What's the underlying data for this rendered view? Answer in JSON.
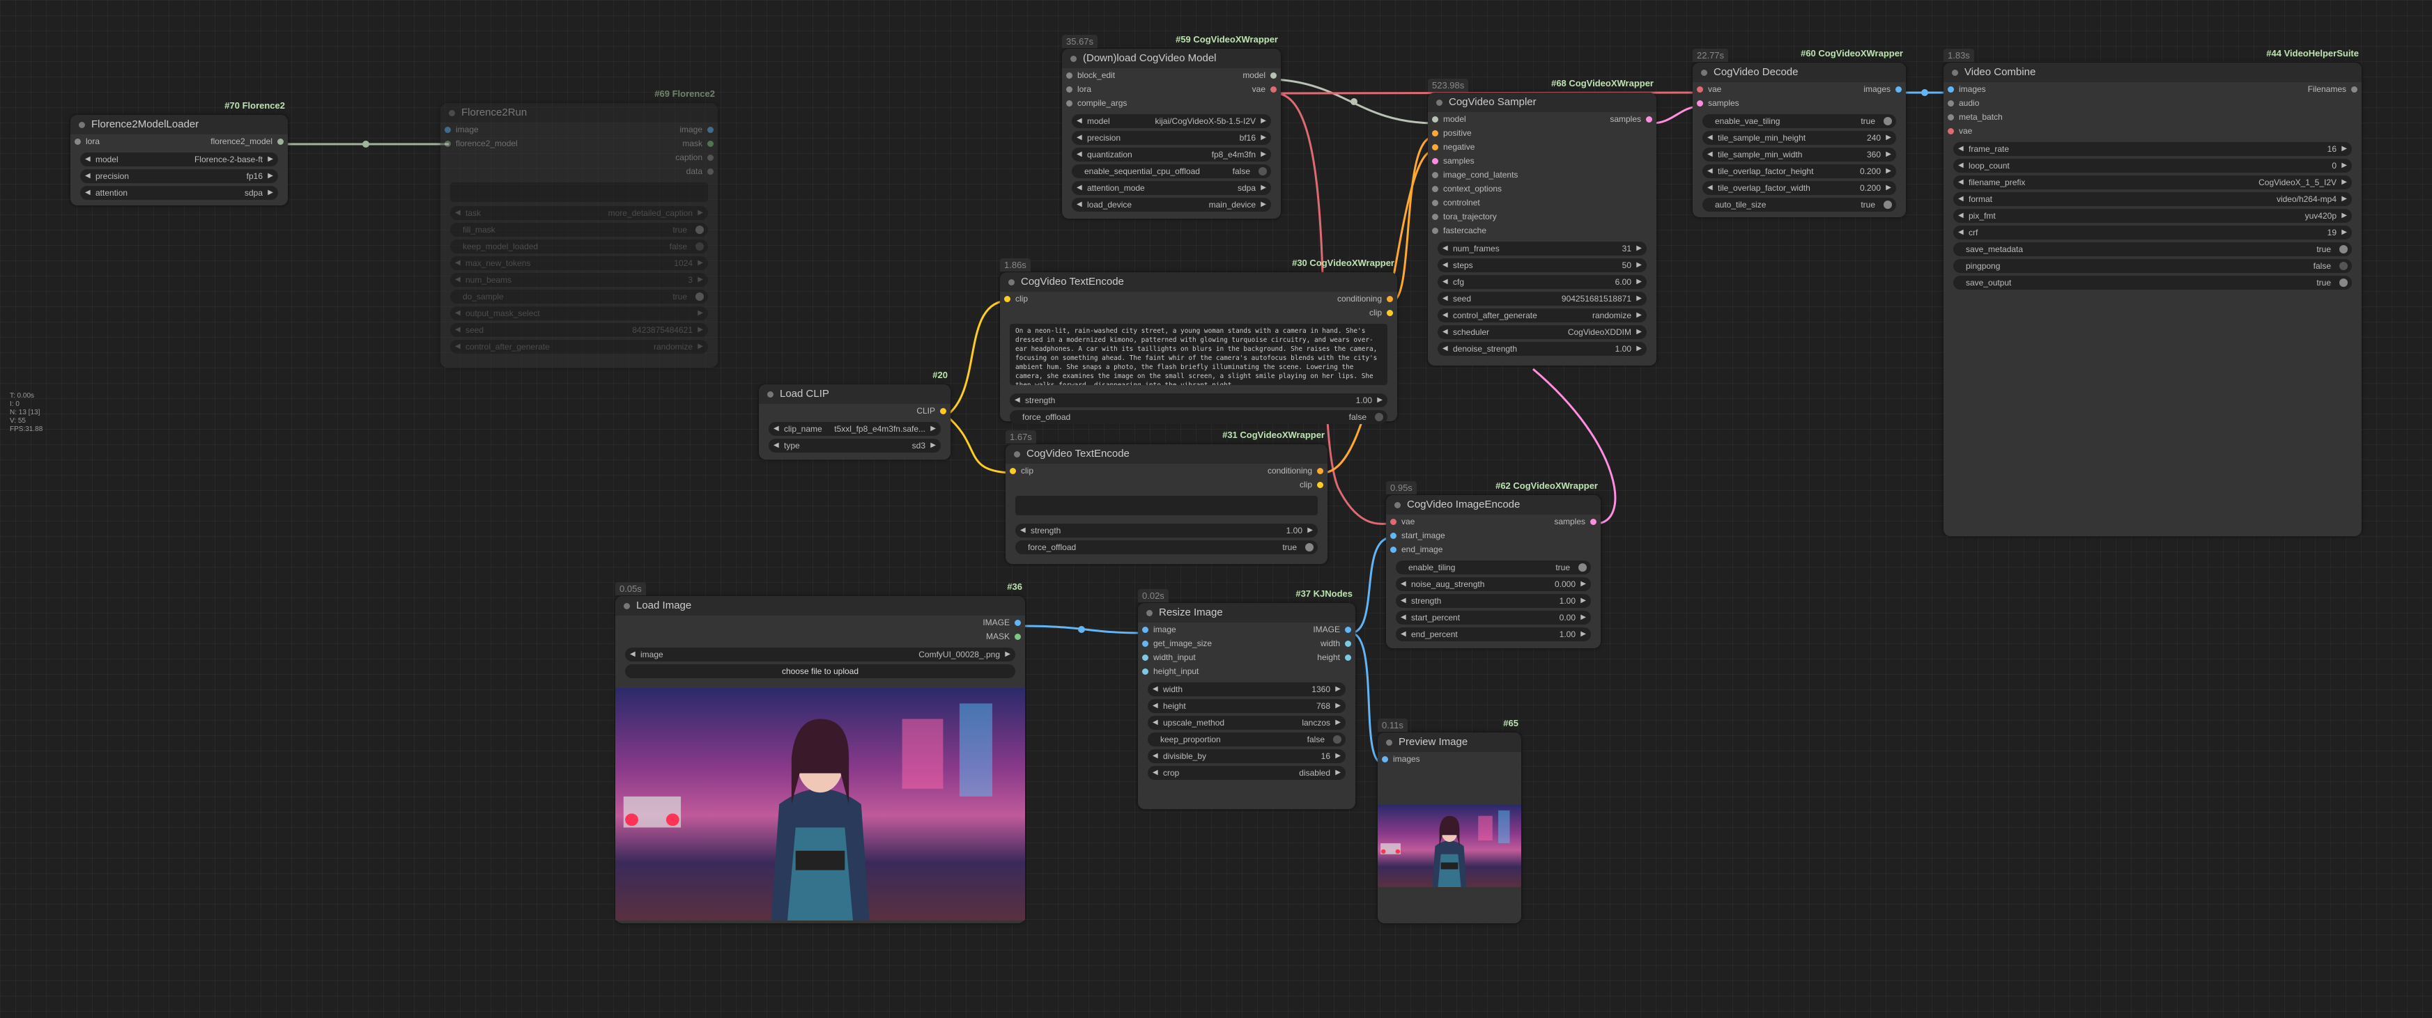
{
  "stats": [
    "T: 0.00s",
    "I: 0",
    "N: 13 [13]",
    "V: 55",
    "FPS:31.88"
  ],
  "nodes": {
    "florence_loader": {
      "title": "Florence2ModelLoader",
      "tag": "#70 Florence2",
      "in": [
        "lora"
      ],
      "out": [
        "florence2_model"
      ],
      "w": [
        [
          "model",
          "Florence-2-base-ft"
        ],
        [
          "precision",
          "fp16"
        ],
        [
          "attention",
          "sdpa"
        ]
      ]
    },
    "florence_run": {
      "title": "Florence2Run",
      "tag": "#69 Florence2",
      "in": [
        "image",
        "florence2_model"
      ],
      "out": [
        "image",
        "mask",
        "caption",
        "data"
      ],
      "text_lbl": "text",
      "w": [
        [
          "task",
          "more_detailed_caption"
        ],
        [
          "fill_mask",
          "true"
        ],
        [
          "keep_model_loaded",
          "false"
        ],
        [
          "max_new_tokens",
          "1024"
        ],
        [
          "num_beams",
          "3"
        ],
        [
          "do_sample",
          "true"
        ],
        [
          "output_mask_select",
          ""
        ],
        [
          "seed",
          "842387548462​1"
        ],
        [
          "control_after_generate",
          "randomize"
        ]
      ]
    },
    "download": {
      "title": "(Down)load CogVideo Model",
      "tag": "#59 CogVideoXWrapper",
      "badge": "35.67s",
      "in": [
        "block_edit",
        "lora",
        "compile_args"
      ],
      "out": [
        "model",
        "vae"
      ],
      "w": [
        [
          "model",
          "kijai/CogVideoX-5b-1.5-I2V"
        ],
        [
          "precision",
          "bf16"
        ],
        [
          "quantization",
          "fp8_e4m3fn"
        ],
        [
          "enable_sequential_cpu_offload",
          "false"
        ],
        [
          "attention_mode",
          "sdpa"
        ],
        [
          "load_device",
          "main_device"
        ]
      ]
    },
    "sampler": {
      "title": "CogVideo Sampler",
      "tag": "#68 CogVideoXWrapper",
      "badge": "523.98s",
      "in": [
        "model",
        "positive",
        "negative",
        "samples",
        "image_cond_latents",
        "context_options",
        "controlnet",
        "tora_trajectory",
        "fastercache"
      ],
      "out": [
        "samples"
      ],
      "w": [
        [
          "num_frames",
          "31"
        ],
        [
          "steps",
          "50"
        ],
        [
          "cfg",
          "6.00"
        ],
        [
          "seed",
          "904251681518871"
        ],
        [
          "control_after_generate",
          "randomize"
        ],
        [
          "scheduler",
          "CogVideoXDDIM"
        ],
        [
          "denoise_strength",
          "1.00"
        ]
      ]
    },
    "decode": {
      "title": "CogVideo Decode",
      "tag": "#60 CogVideoXWrapper",
      "badge": "22.77s",
      "in": [
        "vae",
        "samples"
      ],
      "out": [
        "images"
      ],
      "w": [
        [
          "enable_vae_tiling",
          "true"
        ],
        [
          "tile_sample_min_height",
          "240"
        ],
        [
          "tile_sample_min_width",
          "360"
        ],
        [
          "tile_overlap_factor_height",
          "0.200"
        ],
        [
          "tile_overlap_factor_width",
          "0.200"
        ],
        [
          "auto_tile_size",
          "true"
        ]
      ]
    },
    "combine": {
      "title": "Video Combine",
      "tag": "#44 VideoHelperSuite",
      "badge": "1.83s",
      "in": [
        "images",
        "audio",
        "meta_batch",
        "vae"
      ],
      "out": [
        "Filenames"
      ],
      "w": [
        [
          "frame_rate",
          "16"
        ],
        [
          "loop_count",
          "0"
        ],
        [
          "filename_prefix",
          "CogVideoX_1_5_I2V"
        ],
        [
          "format",
          "video/h264-mp4"
        ],
        [
          "pix_fmt",
          "yuv420p"
        ],
        [
          "crf",
          "19"
        ],
        [
          "save_metadata",
          "true"
        ],
        [
          "pingpong",
          "false"
        ],
        [
          "save_output",
          "true"
        ]
      ]
    },
    "textencode30": {
      "title": "CogVideo TextEncode",
      "tag": "#30 CogVideoXWrapper",
      "badge": "1.86s",
      "in": [
        "clip"
      ],
      "out": [
        "conditioning",
        "clip"
      ],
      "prompt": "On a neon-lit, rain-washed city street, a young woman stands with a camera in hand. She's dressed in a modernized kimono, patterned with glowing turquoise circuitry, and wears over-ear headphones. A car with its taillights on blurs in the background. She raises the camera, focusing on something ahead. The faint whir of the camera's autofocus blends with the city's ambient hum. She snaps a photo, the flash briefly illuminating the scene. Lowering the camera, she examines the image on the small screen, a slight smile playing on her lips. She then walks forward, disappearing into the vibrant night.",
      "w": [
        [
          "strength",
          "1.00"
        ],
        [
          "force_offload",
          "false"
        ]
      ]
    },
    "textencode31": {
      "title": "CogVideo TextEncode",
      "tag": "#31 CogVideoXWrapper",
      "badge": "1.67s",
      "in": [
        "clip"
      ],
      "out": [
        "conditioning",
        "clip"
      ],
      "w": [
        [
          "strength",
          "1.00"
        ],
        [
          "force_offload",
          "true"
        ]
      ]
    },
    "loadclip": {
      "title": "Load CLIP",
      "tag": "#20",
      "out": [
        "CLIP"
      ],
      "w": [
        [
          "clip_name",
          "t5xxl_fp8_e4m3fn.safe..."
        ],
        [
          "type",
          "sd3"
        ]
      ]
    },
    "imageencode": {
      "title": "CogVideo ImageEncode",
      "tag": "#62 CogVideoXWrapper",
      "badge": "0.95s",
      "in": [
        "vae",
        "start_image",
        "end_image"
      ],
      "out": [
        "samples"
      ],
      "w": [
        [
          "enable_tiling",
          "true"
        ],
        [
          "noise_aug_strength",
          "0.000"
        ],
        [
          "strength",
          "1.00"
        ],
        [
          "start_percent",
          "0.00"
        ],
        [
          "end_percent",
          "1.00"
        ]
      ]
    },
    "loadimage": {
      "title": "Load Image",
      "tag": "#36",
      "badge": "0.05s",
      "out": [
        "IMAGE",
        "MASK"
      ],
      "w": [
        [
          "image",
          "ComfyUI_00028_.png"
        ]
      ],
      "upload": "choose file to upload"
    },
    "resize": {
      "title": "Resize Image",
      "tag": "#37 KJNodes",
      "badge": "0.02s",
      "in": [
        "image",
        "get_image_size",
        "width_input",
        "height_input"
      ],
      "out": [
        "IMAGE",
        "width",
        "height"
      ],
      "w": [
        [
          "width",
          "1360"
        ],
        [
          "height",
          "768"
        ],
        [
          "upscale_method",
          "lanczos"
        ],
        [
          "keep_proportion",
          "false"
        ],
        [
          "divisible_by",
          "16"
        ],
        [
          "crop",
          "disabled"
        ]
      ]
    },
    "preview": {
      "title": "Preview Image",
      "tag": "#65",
      "badge": "0.11s",
      "in": [
        "images"
      ]
    }
  }
}
